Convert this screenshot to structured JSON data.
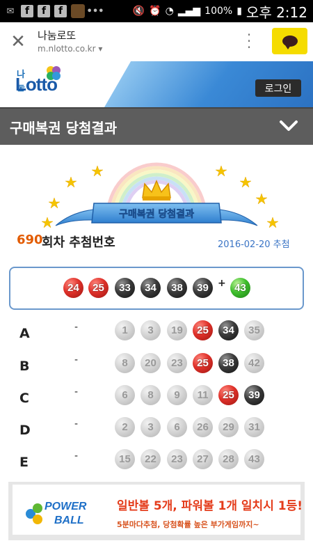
{
  "status_bar": {
    "battery": "100%",
    "time": "오후 2:12"
  },
  "browser": {
    "site_title": "나눔로또",
    "url": "m.nlotto.co.kr"
  },
  "header": {
    "logo_small": "나눔",
    "logo_big": "Lotto",
    "login_label": "로그인"
  },
  "page": {
    "title": "구매복권 당첨결과",
    "banner_text": "구매복권 당첨결과",
    "round_number": "690",
    "round_suffix": "회차 추첨번호",
    "draw_date": "2016-02-20 추첨"
  },
  "winning": {
    "numbers": [
      "24",
      "25",
      "33",
      "34",
      "38",
      "39"
    ],
    "colors": [
      "red",
      "red",
      "black",
      "black",
      "black",
      "black"
    ],
    "plus": "+",
    "bonus": "43",
    "bonus_color": "green"
  },
  "tickets": [
    {
      "label": "A",
      "dash": "-",
      "numbers": [
        "1",
        "3",
        "19",
        "25",
        "34",
        "35"
      ],
      "colors": [
        "gray",
        "gray",
        "gray",
        "red",
        "black",
        "gray"
      ]
    },
    {
      "label": "B",
      "dash": "-",
      "numbers": [
        "8",
        "20",
        "23",
        "25",
        "38",
        "42"
      ],
      "colors": [
        "gray",
        "gray",
        "gray",
        "red",
        "black",
        "gray"
      ]
    },
    {
      "label": "C",
      "dash": "-",
      "numbers": [
        "6",
        "8",
        "9",
        "11",
        "25",
        "39"
      ],
      "colors": [
        "gray",
        "gray",
        "gray",
        "gray",
        "red",
        "black"
      ]
    },
    {
      "label": "D",
      "dash": "-",
      "numbers": [
        "2",
        "3",
        "6",
        "26",
        "29",
        "31"
      ],
      "colors": [
        "gray",
        "gray",
        "gray",
        "gray",
        "gray",
        "gray"
      ]
    },
    {
      "label": "E",
      "dash": "-",
      "numbers": [
        "15",
        "22",
        "23",
        "27",
        "28",
        "43"
      ],
      "colors": [
        "gray",
        "gray",
        "gray",
        "gray",
        "gray",
        "gray"
      ]
    }
  ],
  "ad": {
    "logo_line1": "POWER",
    "logo_line2": "BALL",
    "line1": "일반볼 5개, 파워볼 1개 일치시 1등!",
    "line2": "5분마다추첨, 당첨확률 높은 부가게임까지~"
  }
}
